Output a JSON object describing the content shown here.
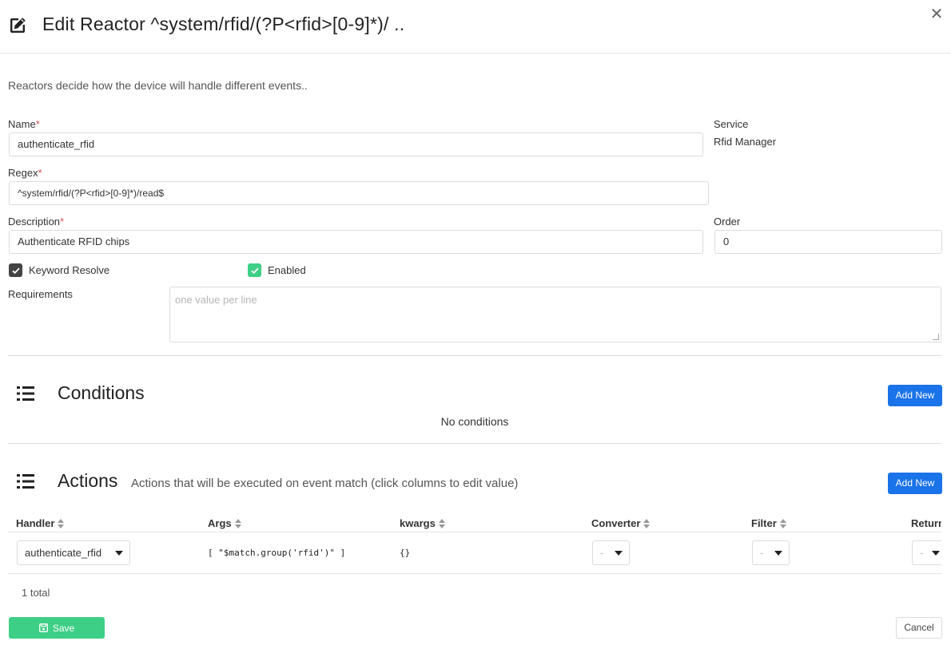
{
  "header": {
    "title": "Edit Reactor ^system/rfid/(?P<rfid>[0-9]*)/ ..",
    "close_symbol": "✕"
  },
  "intro": "Reactors decide how the device will handle different events..",
  "form": {
    "name_label": "Name",
    "name_value": "authenticate_rfid",
    "service_label": "Service",
    "service_value": "Rfid Manager",
    "regex_label": "Regex",
    "regex_value": "^system/rfid/(?P<rfid>[0-9]*)/read$",
    "description_label": "Description",
    "description_value": "Authenticate RFID chips",
    "order_label": "Order",
    "order_value": "0",
    "required_mark": "*",
    "keyword_resolve_label": "Keyword Resolve",
    "keyword_resolve_checked": true,
    "enabled_label": "Enabled",
    "enabled_checked": true,
    "requirements_label": "Requirements",
    "requirements_placeholder": "one value per line"
  },
  "conditions": {
    "title": "Conditions",
    "add_label": "Add New",
    "empty_text": "No conditions"
  },
  "actions": {
    "title": "Actions",
    "subtitle": "Actions that will be executed on event match (click columns to edit value)",
    "add_label": "Add New",
    "columns": [
      "Handler",
      "Args",
      "kwargs",
      "Converter",
      "Filter",
      "Return"
    ],
    "rows": [
      {
        "handler": "authenticate_rfid",
        "args": "[ \"$match.group('rfid')\" ]",
        "kwargs": "{}",
        "converter": "-",
        "filter": "-",
        "return": "-"
      }
    ],
    "total": "1 total"
  },
  "footer": {
    "save_label": "Save",
    "cancel_label": "Cancel"
  },
  "colors": {
    "primary": "#1a73e8",
    "save": "#3ecf86",
    "enabled_checkbox": "#3ecf86",
    "keyword_checkbox": "#444444"
  }
}
